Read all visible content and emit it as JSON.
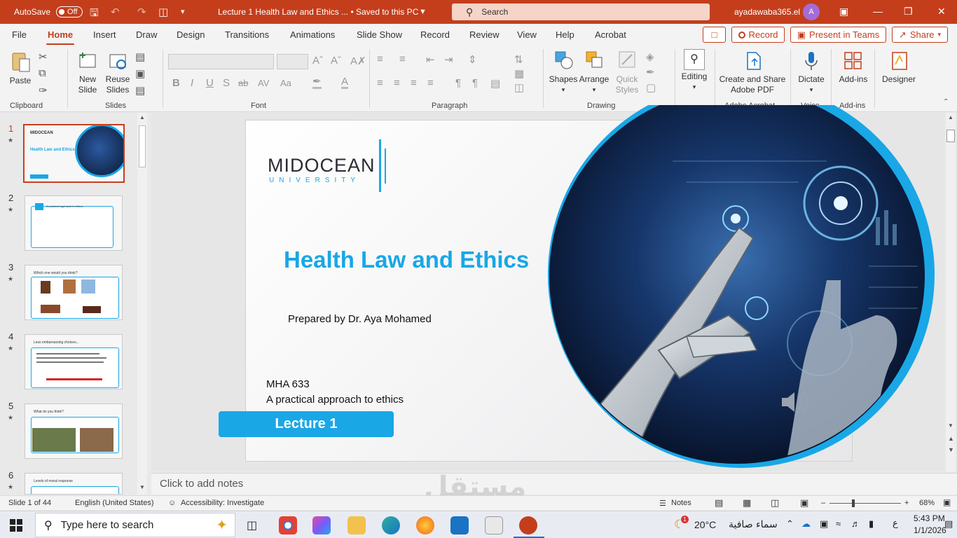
{
  "titlebar": {
    "autosave_label": "AutoSave",
    "autosave_state": "Off",
    "doc_title": "Lecture 1 Health Law and Ethics ...  •  Saved to this PC",
    "search_placeholder": "Search",
    "user": "ayadawaba365.el",
    "avatar_initial": "A"
  },
  "menu": {
    "tabs": [
      "File",
      "Home",
      "Insert",
      "Draw",
      "Design",
      "Transitions",
      "Animations",
      "Slide Show",
      "Record",
      "Review",
      "View",
      "Help",
      "Acrobat"
    ],
    "active": "Home",
    "record_btn": "Record",
    "present_btn": "Present in Teams",
    "share_btn": "Share"
  },
  "ribbon": {
    "paste": "Paste",
    "clipboard": "Clipboard",
    "new_slide_1": "New",
    "new_slide_2": "Slide",
    "reuse_1": "Reuse",
    "reuse_2": "Slides",
    "slides": "Slides",
    "font": "Font",
    "paragraph": "Paragraph",
    "shapes": "Shapes",
    "arrange": "Arrange",
    "quick_1": "Quick",
    "quick_2": "Styles",
    "drawing": "Drawing",
    "editing": "Editing",
    "acrobat_1": "Create and Share",
    "acrobat_2": "Adobe PDF",
    "adobe_acrobat": "Adobe Acrobat",
    "dictate": "Dictate",
    "voice": "Voice",
    "addins": "Add-ins",
    "addins_group": "Add-ins",
    "designer": "Designer",
    "font_btns": [
      "B",
      "I",
      "U",
      "S",
      "ab",
      "AV",
      "Aa",
      "A",
      "A"
    ]
  },
  "thumbnails": [
    {
      "num": "1",
      "title": "Health Law and Ethics",
      "active": true
    },
    {
      "num": "2",
      "title": "A practical approach to ethics",
      "active": false
    },
    {
      "num": "3",
      "title": "Which one would you drink?",
      "active": false
    },
    {
      "num": "4",
      "title": "Less embarrassing choices...",
      "active": false
    },
    {
      "num": "5",
      "title": "What do you think?",
      "active": false
    },
    {
      "num": "6",
      "title": "Levels of moral response",
      "active": false
    }
  ],
  "slide": {
    "logo_main": "MIDOCEAN",
    "logo_sub": "UNIVERSITY",
    "title": "Health Law and Ethics",
    "prepared_by": "Prepared by Dr. Aya Mohamed",
    "course_code": "MHA 633",
    "course_name": "A practical approach to ethics",
    "lecture": "Lecture 1"
  },
  "notes_placeholder": "Click to add notes",
  "statusbar": {
    "slide_count": "Slide 1 of 44",
    "language": "English (United States)",
    "accessibility": "Accessibility: Investigate",
    "notes": "Notes",
    "zoom": "68%"
  },
  "taskbar": {
    "search_placeholder": "Type here to search",
    "weather_temp": "20°C",
    "weather_text": "سماء صافية",
    "lang": "ع",
    "time": "5:43 PM",
    "date": "1/1/2026",
    "weather_badge": "1"
  },
  "colors": {
    "accent": "#c43e1c",
    "slide_blue": "#1aa7e6"
  }
}
